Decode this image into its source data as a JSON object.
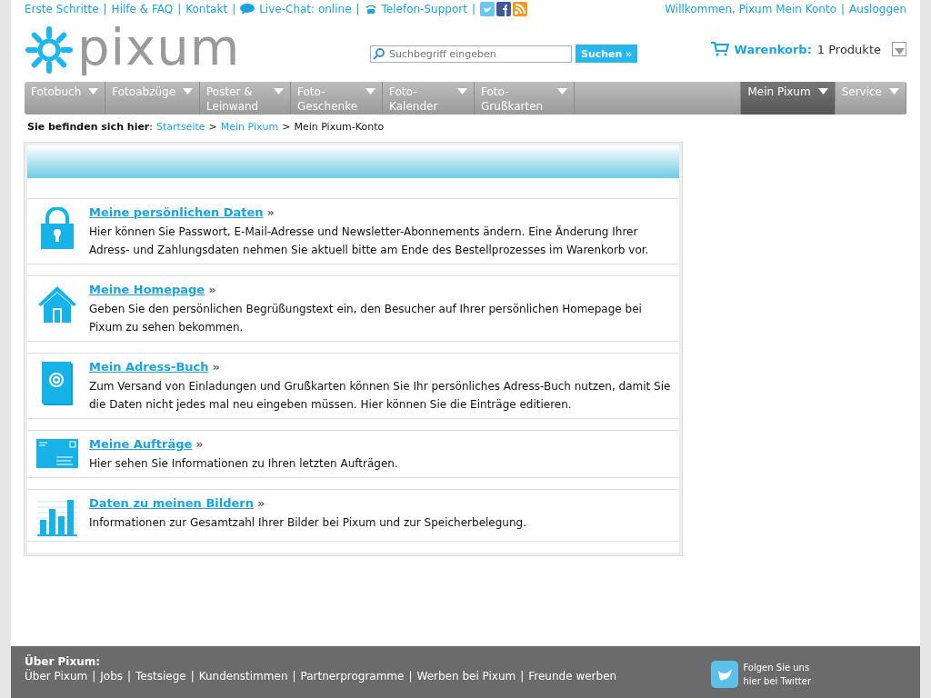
{
  "top_links": [
    "Erste Schritte",
    "Hilfe & FAQ",
    "Kontakt",
    "Live-Chat: online",
    "Telefon-Support"
  ],
  "separator": "|",
  "account_links": [
    "Willkommen, Pixum Mein Konto",
    "Ausloggen"
  ],
  "logo": {
    "text": "pixum"
  },
  "search": {
    "placeholder": "Suchbegriff eingeben",
    "button": "Suchen »"
  },
  "cart": {
    "label": "Warenkorb:",
    "count": "1 Produkte"
  },
  "nav_left": [
    {
      "label": "Fotobuch",
      "selected": false
    },
    {
      "label": "Fotoabzüge",
      "selected": false
    },
    {
      "label": "Poster &\nLeinwand",
      "selected": false
    },
    {
      "label": "Foto-\nGeschenke",
      "selected": false
    },
    {
      "label": "Foto-\nKalender",
      "selected": false
    },
    {
      "label": "Foto-\nGrußkarten",
      "selected": false
    }
  ],
  "nav_right": [
    {
      "label": "Mein Pixum",
      "selected": true
    },
    {
      "label": "Service",
      "selected": false
    }
  ],
  "breadcrumb": {
    "label": "Sie befinden sich hier",
    "colon": ":",
    "links": [
      "Startseite",
      "Mein Pixum"
    ],
    "current": "Mein Pixum-Konto",
    "divider": ">"
  },
  "sections": [
    {
      "title": "Meine persönlichen Daten",
      "arrow": "»",
      "text": "Hier können Sie Passwort, E-Mail-Adresse und Newsletter-Abonnements ändern. Eine Änderung Ihrer Adress- und Zahlungsdaten nehmen Sie aktuell bitte am Ende des Bestellprozesses im Warenkorb vor."
    },
    {
      "title": "Meine Homepage",
      "arrow": "»",
      "text": "Geben Sie den persönlichen Begrüßungstext ein, den Besucher auf Ihrer persönlichen Homepage bei Pixum zu sehen bekommen."
    },
    {
      "title": "Mein Adress-Buch",
      "arrow": "»",
      "text": "Zum Versand von Einladungen und Grußkarten können Sie Ihr persönliches Adress-Buch nutzen, damit Sie die Daten nicht jedes mal neu eingeben müssen. Hier können Sie die Einträge editieren."
    },
    {
      "title": "Meine Aufträge",
      "arrow": "»",
      "text": "Hier sehen Sie Informationen zu Ihren letzten Aufträgen."
    },
    {
      "title": "Daten zu meinen Bildern",
      "arrow": "»",
      "text": "Informationen zur Gesamtzahl Ihrer Bilder bei Pixum und zur Speicherbelegung."
    }
  ],
  "footer": {
    "heading": "Über Pixum:",
    "links": [
      "Über Pixum",
      "Jobs",
      "Testsiege",
      "Kundenstimmen",
      "Partnerprogramme",
      "Werben bei Pixum",
      "Freunde werben"
    ],
    "twitter": "Folgen Sie uns\nhier bei Twitter"
  }
}
